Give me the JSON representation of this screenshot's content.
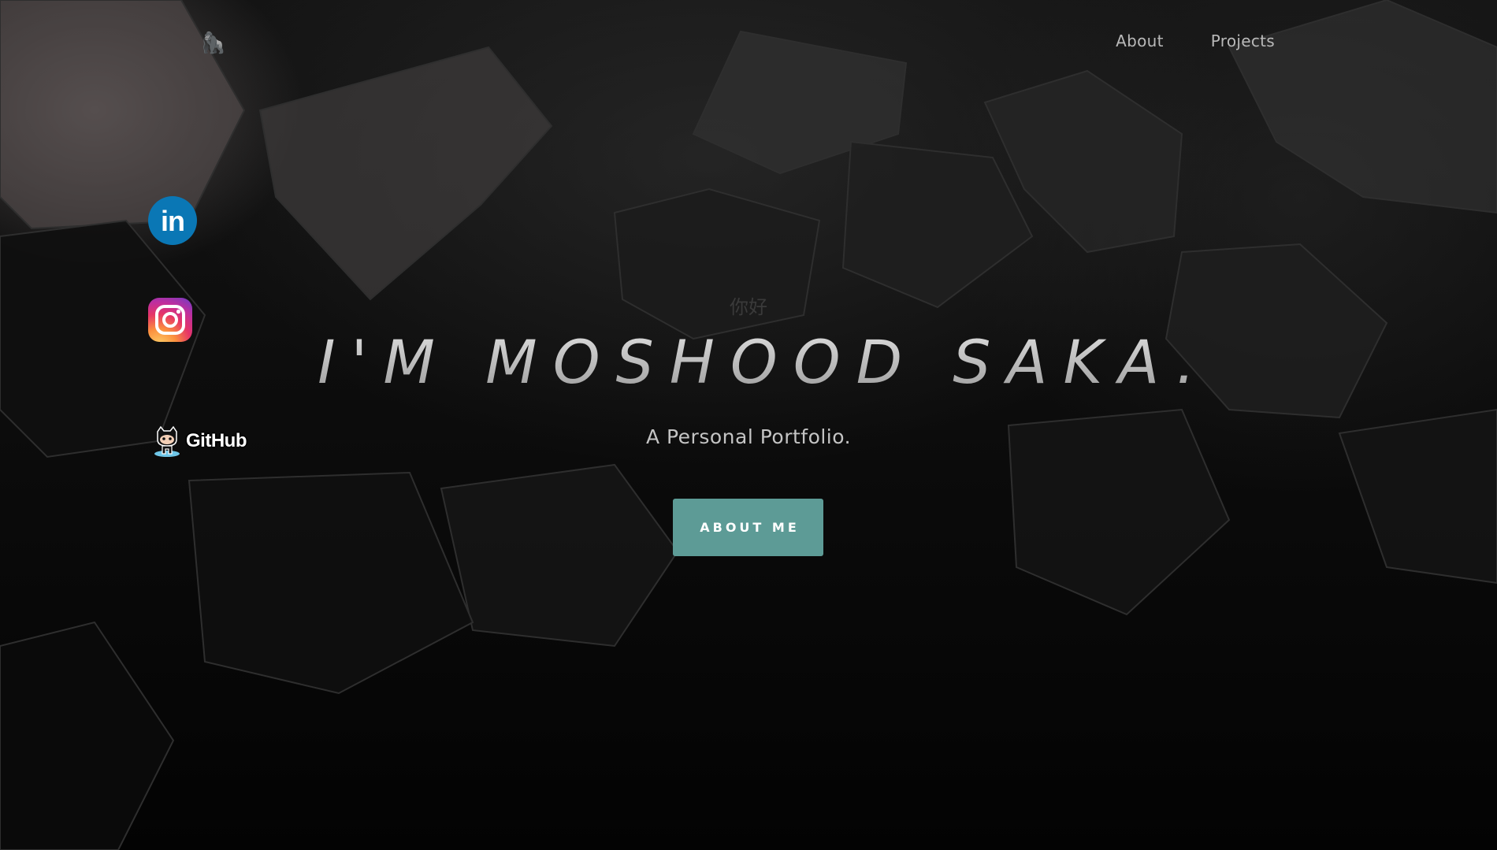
{
  "nav": {
    "logo_icon": "gorilla-emoji",
    "logo_glyph": "🦍",
    "links": [
      {
        "label": "About"
      },
      {
        "label": "Projects"
      }
    ]
  },
  "social": {
    "linkedin": {
      "icon": "linkedin-icon",
      "label": "in"
    },
    "instagram": {
      "icon": "instagram-icon"
    },
    "github": {
      "icon": "github-icon",
      "label": "GitHub"
    }
  },
  "hero": {
    "greeting": "你好",
    "headline": "I'M MOSHOOD SAKA.",
    "subtitle": "A Personal Portfolio.",
    "cta_label": "ABOUT ME"
  },
  "colors": {
    "accent": "#5d9b96",
    "linkedin": "#0a77b5",
    "background": "#050505"
  }
}
